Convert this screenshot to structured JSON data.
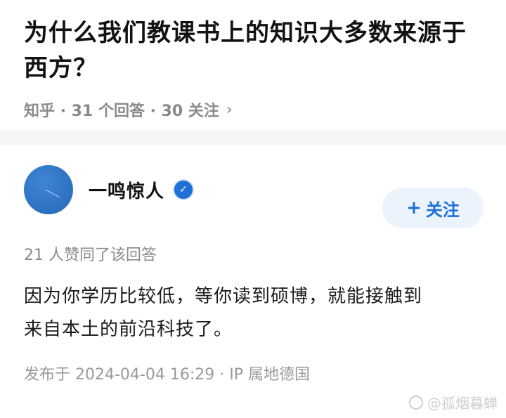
{
  "question": {
    "title": "为什么我们教课书上的知识大多数来源于西方？",
    "meta": "知乎 · 31 个回答 · 30 关注",
    "chevron": "›"
  },
  "answer": {
    "author_name": "一鸣惊人",
    "follow_label": "关注",
    "follow_plus": "+",
    "votes_text": "21 人赞同了该回答",
    "content_line1": "因为你学历比较低，等你读到硕博，就能接触到",
    "content_line2": "来自本土的前沿科技了。",
    "time_text": "发布于 2024-04-04 16:29 · IP 属地德国"
  },
  "watermark": {
    "text": "@孤烟暮蝉",
    "icon": "weibo-icon"
  },
  "colors": {
    "accent": "#1d6fd8",
    "follow_bg": "#ebf3fd",
    "muted": "#8a8a8a"
  }
}
